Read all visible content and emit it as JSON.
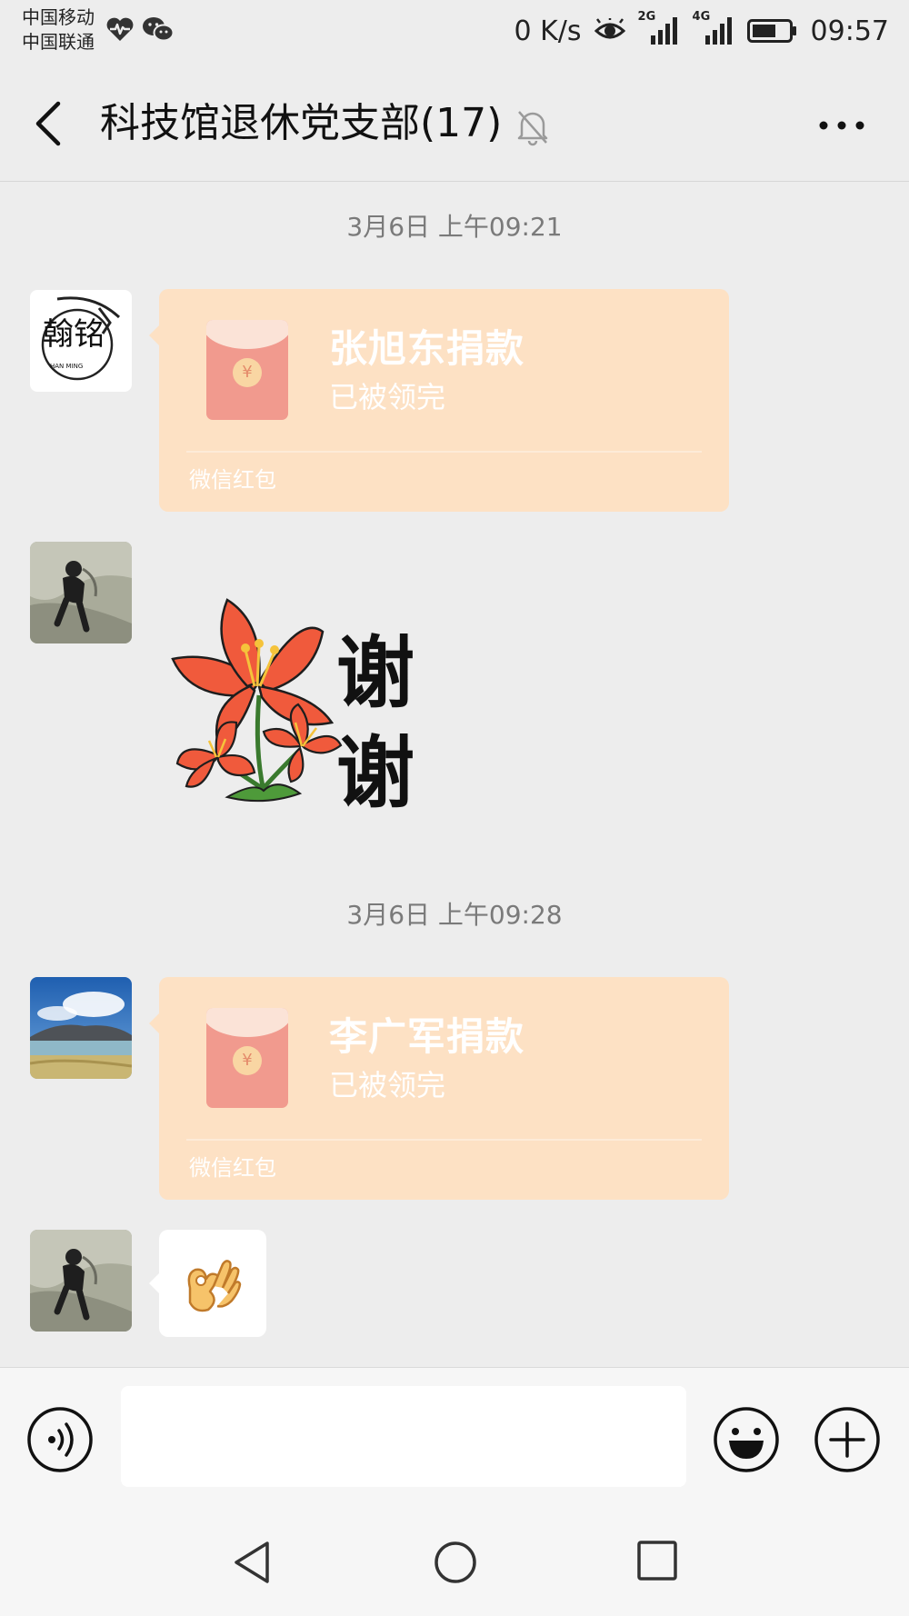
{
  "status_bar": {
    "carrier_1": "中国移动",
    "carrier_2": "中国联通",
    "network_speed": "0 K/s",
    "signal_1_label": "2G",
    "signal_2_label": "4G",
    "time": "09:57",
    "icons": [
      "heartbeat-icon",
      "wechat-icon",
      "eye-icon",
      "signal-icon",
      "battery-icon"
    ]
  },
  "header": {
    "title": "科技馆退休党支部(17)",
    "icons": [
      "back-arrow-icon",
      "mute-bell-icon",
      "more-dots-icon"
    ]
  },
  "messages": [
    {
      "type": "timestamp",
      "text": "3月6日 上午09:21"
    },
    {
      "type": "red_packet",
      "avatar": "calligraphy-logo-avatar",
      "avatar_text": "翰铭",
      "avatar_subtext": "HAN MING",
      "title": "张旭东捐款",
      "status": "已被领完",
      "source": "微信红包"
    },
    {
      "type": "sticker",
      "avatar": "hiker-photo-avatar",
      "text_line_1": "谢",
      "text_line_2": "谢"
    },
    {
      "type": "timestamp",
      "text": "3月6日 上午09:28"
    },
    {
      "type": "red_packet",
      "avatar": "landscape-photo-avatar",
      "title": "李广军捐款",
      "status": "已被领完",
      "source": "微信红包"
    },
    {
      "type": "emoji",
      "avatar": "hiker-photo-avatar",
      "emoji": "ok-hand-icon"
    }
  ],
  "input_bar": {
    "value": "",
    "icons": [
      "voice-icon",
      "emoji-icon",
      "plus-icon"
    ]
  },
  "nav_bar": {
    "icons": [
      "nav-back-icon",
      "nav-home-icon",
      "nav-recents-icon"
    ]
  },
  "colors": {
    "background": "#ededed",
    "red_packet": "#fde1c4",
    "envelope": "#f19a8e",
    "text_muted": "#7a7a7a"
  }
}
